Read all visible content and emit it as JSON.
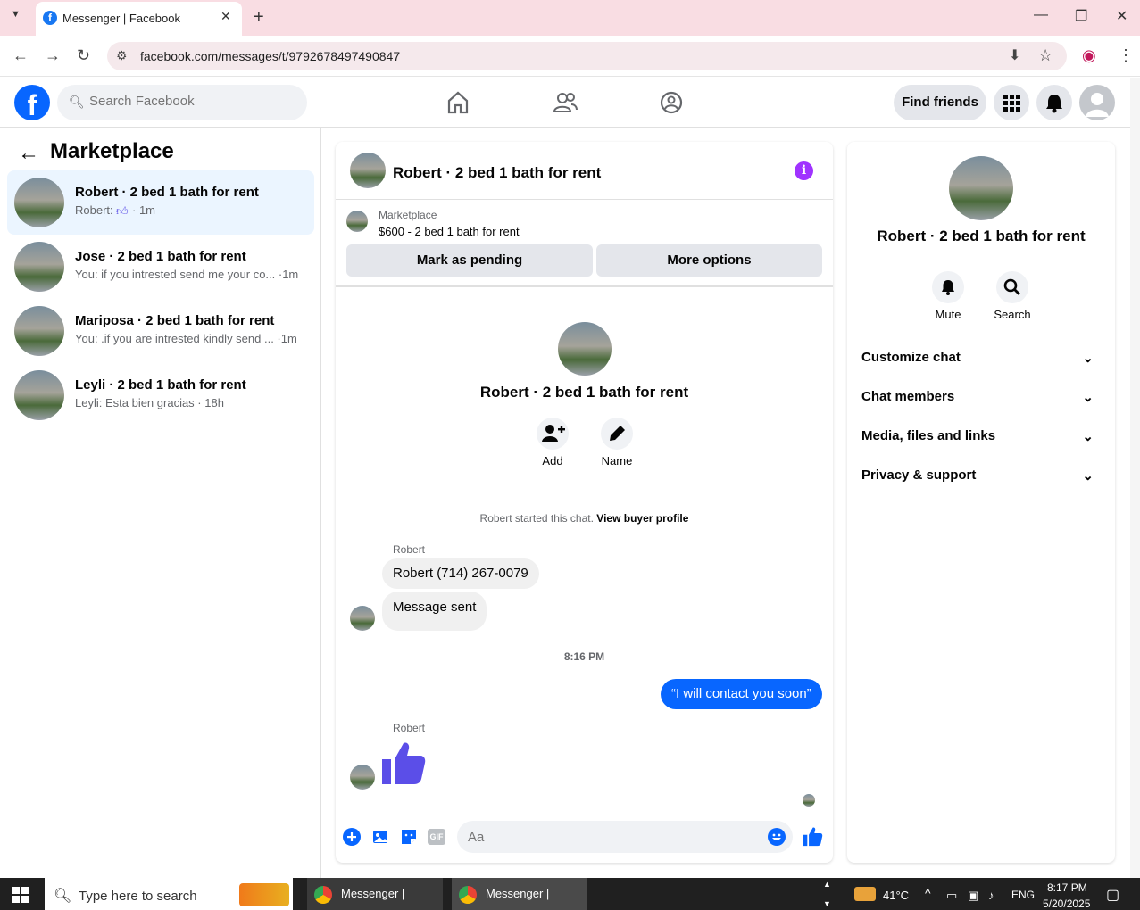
{
  "browser": {
    "tab_title": "Messenger | Facebook",
    "tab_favicon": "f",
    "url": "facebook.com/messages/t/9792678497490847"
  },
  "fb": {
    "logo": "f",
    "search_placeholder": "Search Facebook",
    "find_friends": "Find friends"
  },
  "left": {
    "title": "Marketplace",
    "conversations": [
      {
        "title": "Robert · 2 bed 1 bath for rent",
        "preview": "Robert:",
        "time": "· 1m",
        "active": true
      },
      {
        "title": "Jose · 2 bed 1 bath for rent",
        "preview": "You: if you intrested send me your co... ·1m",
        "active": false
      },
      {
        "title": "Mariposa · 2 bed 1 bath for rent",
        "preview": "You: .if you are intrested kindly send ... ·1m",
        "active": false
      },
      {
        "title": "Leyli · 2 bed 1 bath for rent",
        "preview": "Leyli: Esta bien gracias · 18h",
        "active": false
      }
    ]
  },
  "chat": {
    "title": "Robert · 2 bed 1 bath for rent",
    "info": "i",
    "marketplace_label": "Marketplace",
    "listing": "$600 - 2 bed 1 bath for rent",
    "mark_pending": "Mark as pending",
    "more_options": "More options",
    "profile_name": "Robert · 2 bed 1 bath for rent",
    "add_label": "Add",
    "name_label": "Name",
    "started_text": "Robert started this chat.",
    "view_buyer": "View buyer profile",
    "sender1": "Robert",
    "msg1": "Robert (714) 267-0079",
    "msg2": "Message sent",
    "timestamp": "8:16 PM",
    "msg_out": "“I will contact you soon”",
    "sender2": "Robert",
    "composer_placeholder": "Aa",
    "gif": "GIF"
  },
  "right": {
    "name": "Robert · 2 bed 1 bath for rent",
    "mute": "Mute",
    "search": "Search",
    "sections": [
      "Customize chat",
      "Chat members",
      "Media, files and links",
      "Privacy & support"
    ]
  },
  "taskbar": {
    "search_placeholder": "Type here to search",
    "app1": "Messenger | Faceb...",
    "app2": "Messenger | Faceb...",
    "temp": "41°C",
    "lang": "ENG",
    "time": "8:17 PM",
    "date": "5/20/2025"
  },
  "colors": {
    "brand": "#0866ff",
    "like": "#5b4ee8",
    "info": "#a033ff"
  }
}
